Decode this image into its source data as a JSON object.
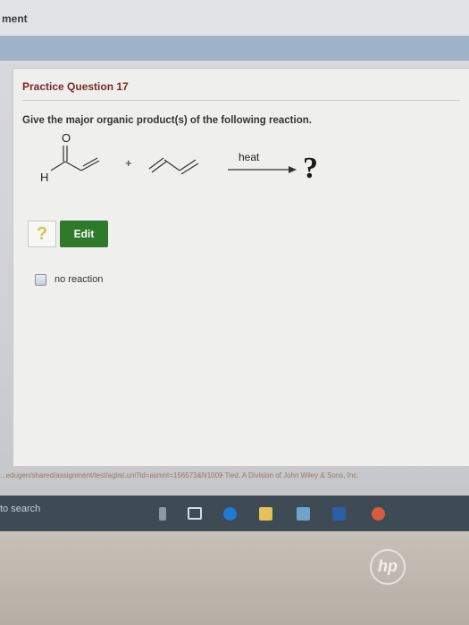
{
  "header": {
    "title": "ment"
  },
  "question": {
    "title": "Practice Question 17",
    "prompt": "Give the major organic product(s) of the following reaction.",
    "reaction": {
      "aldehyde_O": "O",
      "aldehyde_H": "H",
      "plus": "+",
      "condition": "heat",
      "product": "?"
    }
  },
  "answer": {
    "placeholder_glyph": "?",
    "edit_label": "Edit"
  },
  "options": {
    "no_reaction_label": "no reaction"
  },
  "status_bar": {
    "url": "...edugen/shared/assignment/test/aglist.uni?id=asmnt=156573&N1009 Tied. A Division of John Wiley & Sons, Inc."
  },
  "taskbar": {
    "search_text": "to search"
  },
  "bezel": {
    "logo": "hp"
  }
}
